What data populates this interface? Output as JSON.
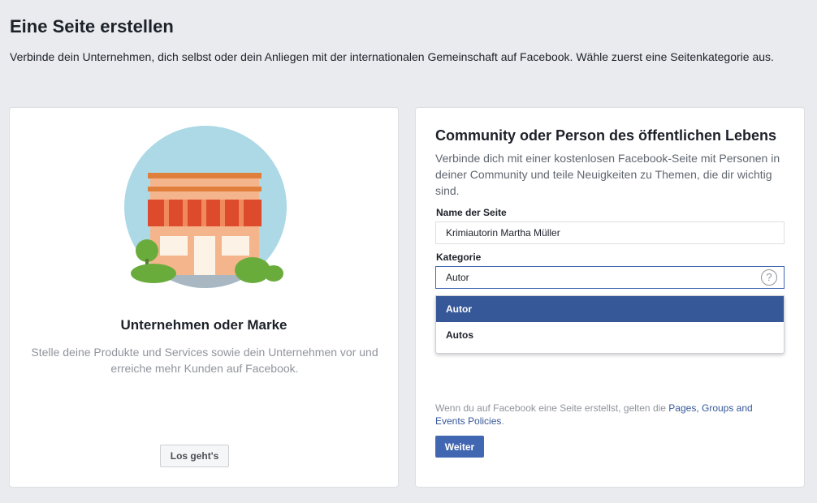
{
  "page": {
    "title": "Eine Seite erstellen",
    "subtitle": "Verbinde dein Unternehmen, dich selbst oder dein Anliegen mit der internationalen Gemeinschaft auf Facebook. Wähle zuerst eine Seitenkategorie aus."
  },
  "business_card": {
    "title": "Unternehmen oder Marke",
    "description": "Stelle deine Produkte und Services sowie dein Unternehmen vor und erreiche mehr Kunden auf Facebook.",
    "button_label": "Los geht's",
    "illustration_icon": "storefront-icon"
  },
  "community_card": {
    "title": "Community oder Person des öffentlichen Lebens",
    "description": "Verbinde dich mit einer kostenlosen Facebook-Seite mit Personen in deiner Community und teile Neuigkeiten zu Themen, die dir wichtig sind.",
    "name_label": "Name der Seite",
    "name_value": "Krimiautorin Martha Müller",
    "category_label": "Kategorie",
    "category_value": "Autor",
    "help_icon": "question-icon",
    "help_glyph": "?",
    "suggestions": [
      "Autor",
      "Autos"
    ],
    "legal_prefix": "Wenn du auf Facebook eine Seite erstellst, gelten die ",
    "legal_link": "Pages, Groups and Events Policies",
    "legal_suffix": ".",
    "button_label": "Weiter"
  },
  "colors": {
    "background": "#e9ebee",
    "brand_blue": "#4267b2",
    "highlight": "#365899"
  }
}
